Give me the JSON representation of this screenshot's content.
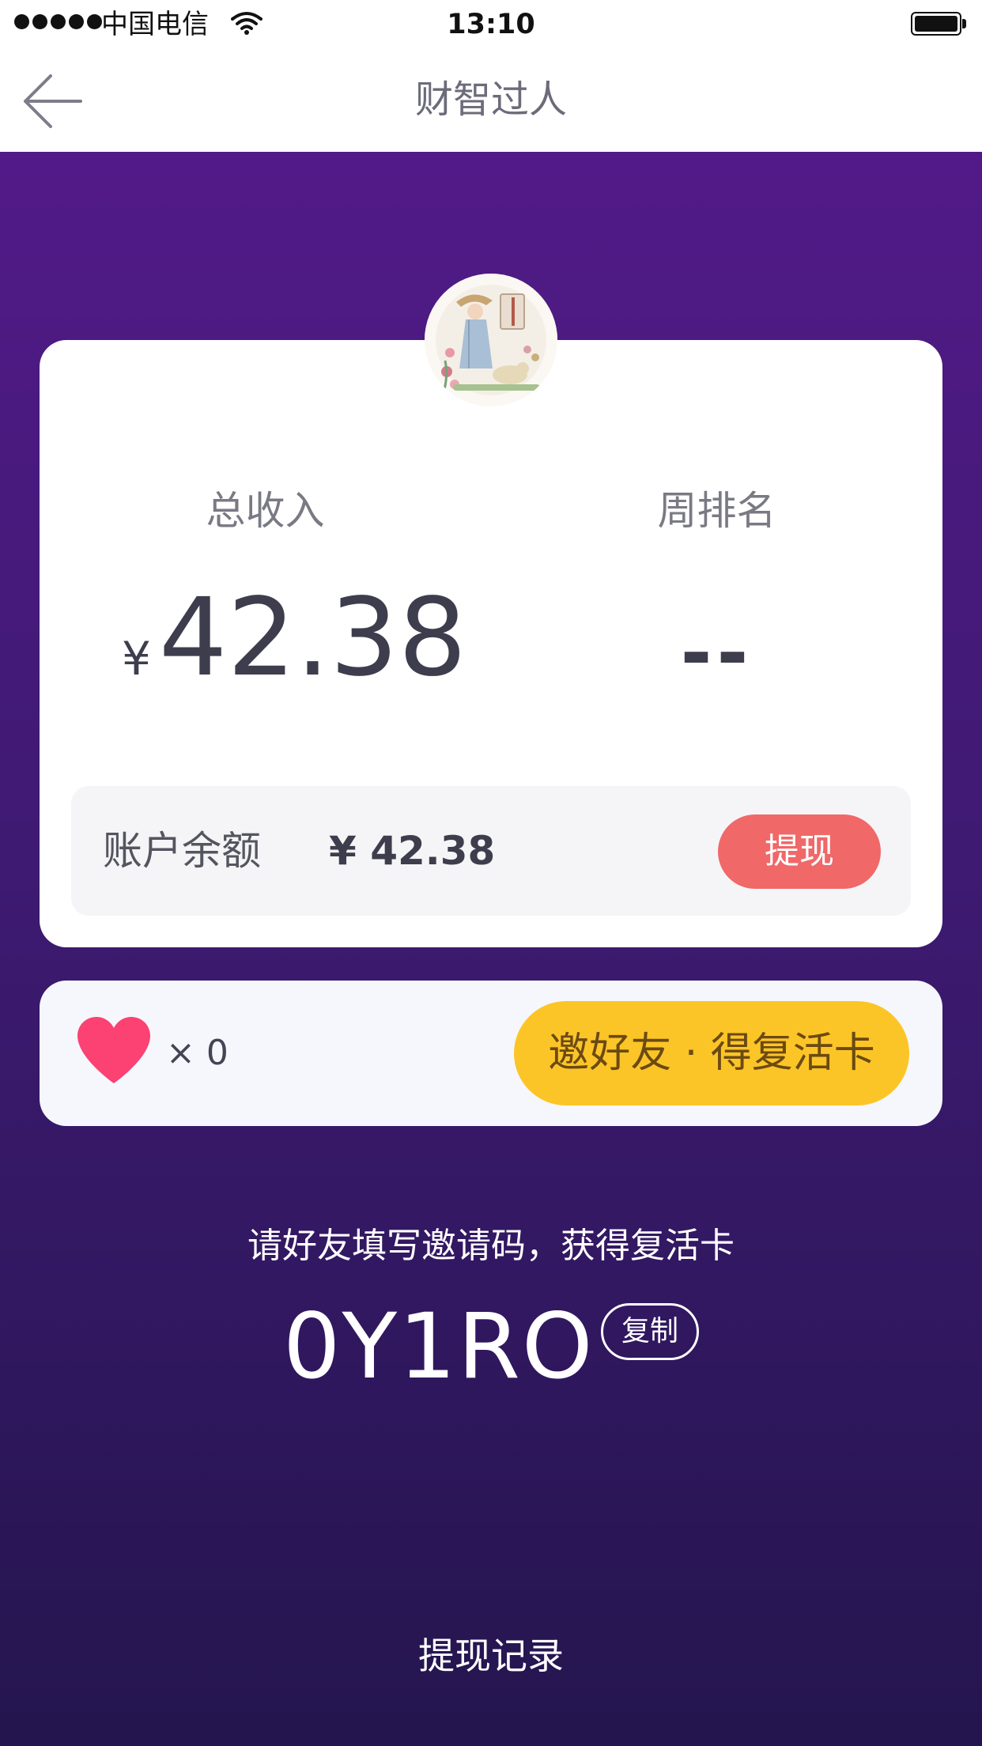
{
  "status_bar": {
    "carrier": "中国电信",
    "time": "13:10"
  },
  "nav": {
    "title": "财智过人",
    "back_icon": "arrow-left-icon"
  },
  "stats": {
    "income_label": "总收入",
    "rank_label": "周排名",
    "currency_symbol": "¥",
    "income_value": "42.38",
    "rank_value": "--"
  },
  "balance": {
    "label": "账户余额",
    "value": "¥ 42.38",
    "withdraw_label": "提现"
  },
  "lives": {
    "icon": "heart-icon",
    "count": "× 0",
    "invite_label": "邀好友 · 得复活卡"
  },
  "invite": {
    "hint": "请好友填写邀请码，获得复活卡",
    "code": "0Y1RO",
    "copy_label": "复制"
  },
  "footer": {
    "history_label": "提现记录"
  },
  "colors": {
    "purple_top": "#521a88",
    "purple_bottom": "#24154e",
    "withdraw_red": "#f06868",
    "invite_yellow": "#fcc527",
    "heart_pink": "#fb4272"
  }
}
